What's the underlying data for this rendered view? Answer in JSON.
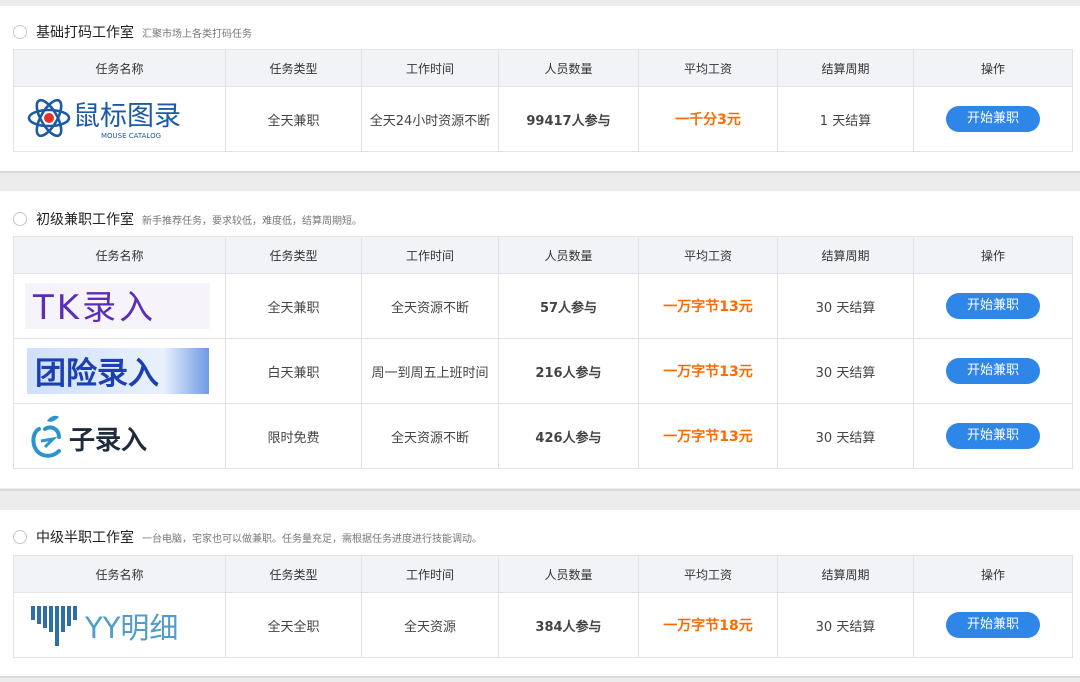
{
  "columns": [
    "任务名称",
    "任务类型",
    "工作时间",
    "人员数量",
    "平均工资",
    "结算周期",
    "操作"
  ],
  "action_label": "开始兼职",
  "colors": {
    "accent": "#2e86e8",
    "pay": "#ff6a00"
  },
  "sections": [
    {
      "title": "基础打码工作室",
      "subtitle": "汇聚市场上各类打码任务",
      "rows": [
        {
          "logo": {
            "type": "mouse",
            "text": "鼠标图录",
            "sub": "MOUSE CATALOG"
          },
          "task_type": "全天兼职",
          "work_time": "全天24小时资源不断",
          "people": "99417人参与",
          "pay": "一千分3元",
          "period": "1 天结算"
        }
      ]
    },
    {
      "title": "初级兼职工作室",
      "subtitle": "新手推荐任务，要求较低，难度低，结算周期短。",
      "rows": [
        {
          "logo": {
            "type": "tk",
            "text": "TK录入"
          },
          "task_type": "全天兼职",
          "work_time": "全天资源不断",
          "people": "57人参与",
          "pay": "一万字节13元",
          "period": "30 天结算"
        },
        {
          "logo": {
            "type": "group",
            "text": "团险录入"
          },
          "task_type": "白天兼职",
          "work_time": "周一到周五上班时间",
          "people": "216人参与",
          "pay": "一万字节13元",
          "period": "30 天结算"
        },
        {
          "logo": {
            "type": "zi",
            "text": "子录入"
          },
          "task_type": "限时免费",
          "work_time": "全天资源不断",
          "people": "426人参与",
          "pay": "一万字节13元",
          "period": "30 天结算"
        }
      ]
    },
    {
      "title": "中级半职工作室",
      "subtitle": "一台电脑，宅家也可以做兼职。任务量充足，需根据任务进度进行技能调动。",
      "rows": [
        {
          "logo": {
            "type": "yy",
            "text": "YY明细"
          },
          "task_type": "全天全职",
          "work_time": "全天资源",
          "people": "384人参与",
          "pay": "一万字节18元",
          "period": "30 天结算"
        }
      ]
    }
  ]
}
